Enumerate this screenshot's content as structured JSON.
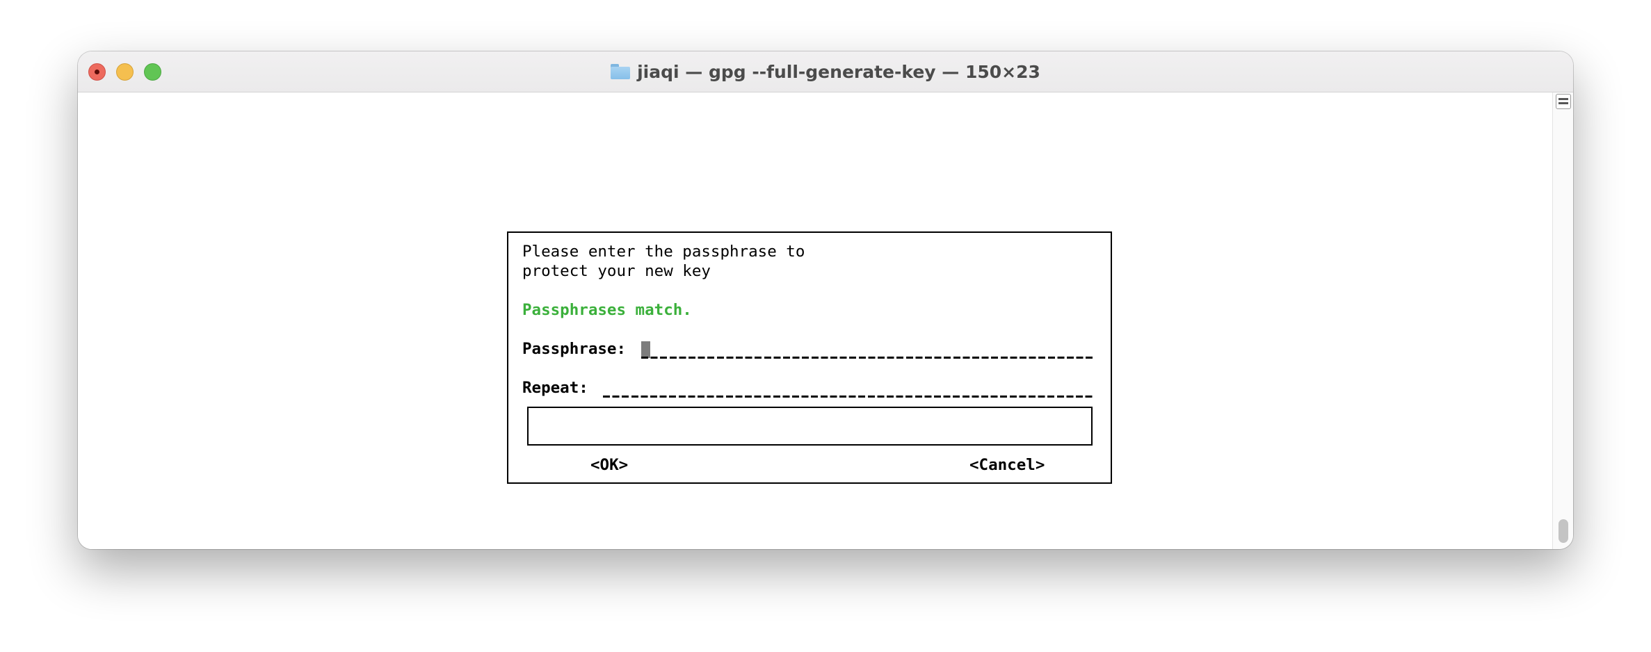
{
  "window": {
    "title": "jiaqi — gpg --full-generate-key — 150×23"
  },
  "dialog": {
    "prompt_line1": "Please enter the passphrase to",
    "prompt_line2": "protect your new key",
    "status_message": "Passphrases match.",
    "passphrase_label": "Passphrase:",
    "repeat_label": "Repeat:",
    "ok_button": "<OK>",
    "cancel_button": "<Cancel>"
  },
  "colors": {
    "status_match": "#3bb03b",
    "cursor": "#7d7d7d",
    "close": "#ed6a5e",
    "minimize": "#f5bf4f",
    "zoom": "#61c554"
  },
  "icons": {
    "title": "folder-icon",
    "scroll": "scroll-indicator-icon"
  }
}
